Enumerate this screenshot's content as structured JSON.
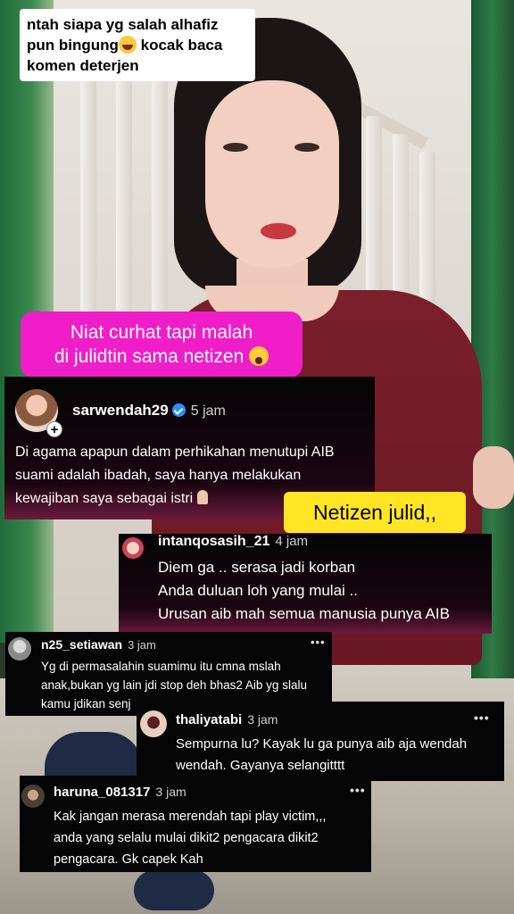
{
  "caption": {
    "line1": "ntah siapa yg salah alhafiz",
    "line2_pre": "pun bingung",
    "line2_post": " kocak baca",
    "line3": "komen deterjen"
  },
  "banner": {
    "line1": "Niat curhat tapi malah",
    "line2": "di julidtin sama netizen"
  },
  "main_comment": {
    "username": "sarwendah29",
    "time": "5 jam",
    "lines": [
      "Di agama apapun dalam perhikahan menutupi AIB",
      "suami adalah ibadah, saya hanya  melakukan",
      "kewajiban saya sebagai istri"
    ]
  },
  "tag": {
    "label": "Netizen julid,,"
  },
  "comments": [
    {
      "username": "intanqosasih_21",
      "time": "4 jam",
      "lines": [
        "Diem ga .. serasa jadi korban",
        "Anda duluan loh yang mulai ..",
        "Urusan aib mah semua manusia punya AIB"
      ]
    },
    {
      "username": "n25_setiawan",
      "time": "3 jam",
      "lines": [
        "Yg di permasalahin suamimu itu cmna mslah",
        "anak,bukan yg lain jdi stop deh bhas2 Aib yg slalu",
        "kamu jdikan senj"
      ]
    },
    {
      "username": "thaliyatabi",
      "time": "3 jam",
      "lines": [
        "Sempurna lu? Kayak lu ga punya aib aja wendah",
        "wendah. Gayanya selangitttt"
      ]
    },
    {
      "username": "haruna_081317",
      "time": "3 jam",
      "lines": [
        "Kak jangan merasa merendah tapi play victim,,,",
        "anda yang selalu mulai dikit2 pengacara dikit2",
        "pengacara. Gk capek Kah"
      ]
    }
  ],
  "more_label": "•••",
  "icons": {
    "caption_emoji": "rolling-laughing-icon",
    "banner_emoji": "surprised-face-icon",
    "verified": "verified-badge-icon",
    "pray": "praying-hands-icon",
    "plus": "+"
  }
}
